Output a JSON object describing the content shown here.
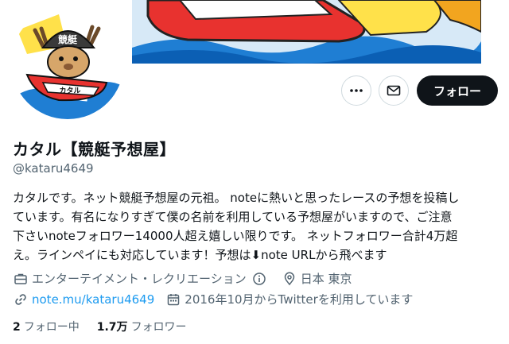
{
  "profile": {
    "name": "カタル【競艇予想屋】",
    "handle": "@kataru4649",
    "bio_lines": [
      "カタルです。ネット競艇予想屋の元祖。 noteに熱いと思ったレースの予想を投稿し",
      "ています。有名になりすぎて僕の名前を利用している予想屋がいますので、ご注意",
      "下さいnoteフォロワー14000人超え嬉しい限りです。 ネットフォロワー合計4万超",
      "え。ラインペイにも対応しています！予想は⬇note URLから飛べます"
    ],
    "avatar_text": {
      "helmet": "競艇",
      "boat": "カタル"
    }
  },
  "actions": {
    "follow_label": "フォロー",
    "more_icon": "more-icon",
    "mail_icon": "mail-icon"
  },
  "meta": {
    "category": "エンターテイメント・レクリエーション",
    "location": "日本 東京",
    "url": "note.mu/kataru4649",
    "joined": "2016年10月からTwitterを利用しています"
  },
  "stats": {
    "following_count": "2",
    "following_label": "フォロー中",
    "followers_count": "1.7万",
    "followers_label": "フォロワー"
  },
  "colors": {
    "accent_link": "#1d9bf0",
    "follow_button_bg": "#0f1419",
    "secondary_text": "#536471"
  }
}
